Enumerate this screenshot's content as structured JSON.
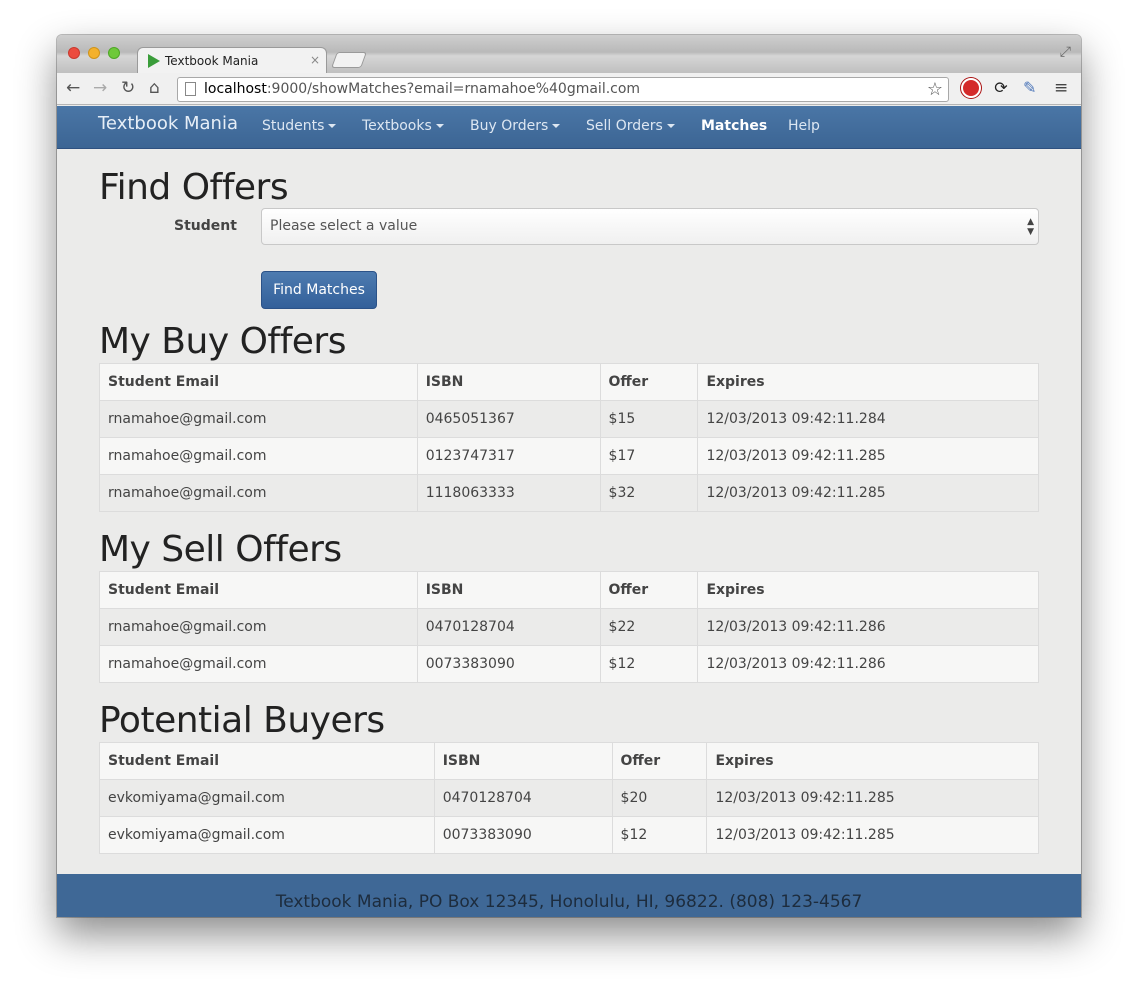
{
  "browser": {
    "tab_title": "Textbook Mania",
    "tab_close": "×",
    "url_host": "localhost",
    "url_rest": ":9000/showMatches?email=rnamahoe%40gmail.com"
  },
  "navbar": {
    "brand": "Textbook Mania",
    "items": [
      {
        "label": "Students",
        "dropdown": true
      },
      {
        "label": "Textbooks",
        "dropdown": true
      },
      {
        "label": "Buy Orders",
        "dropdown": true
      },
      {
        "label": "Sell Orders",
        "dropdown": true
      },
      {
        "label": "Matches",
        "dropdown": false,
        "active": true
      },
      {
        "label": "Help",
        "dropdown": false
      }
    ]
  },
  "find_offers": {
    "title": "Find Offers",
    "student_label": "Student",
    "select_value": "Please select a value",
    "button_label": "Find Matches"
  },
  "buy_offers": {
    "title": "My Buy Offers",
    "headers": [
      "Student Email",
      "ISBN",
      "Offer",
      "Expires"
    ],
    "rows": [
      [
        "rnamahoe@gmail.com",
        "0465051367",
        "$15",
        "12/03/2013 09:42:11.284"
      ],
      [
        "rnamahoe@gmail.com",
        "0123747317",
        "$17",
        "12/03/2013 09:42:11.285"
      ],
      [
        "rnamahoe@gmail.com",
        "1118063333",
        "$32",
        "12/03/2013 09:42:11.285"
      ]
    ]
  },
  "sell_offers": {
    "title": "My Sell Offers",
    "headers": [
      "Student Email",
      "ISBN",
      "Offer",
      "Expires"
    ],
    "rows": [
      [
        "rnamahoe@gmail.com",
        "0470128704",
        "$22",
        "12/03/2013 09:42:11.286"
      ],
      [
        "rnamahoe@gmail.com",
        "0073383090",
        "$12",
        "12/03/2013 09:42:11.286"
      ]
    ]
  },
  "potential_buyers": {
    "title": "Potential Buyers",
    "headers": [
      "Student Email",
      "ISBN",
      "Offer",
      "Expires"
    ],
    "rows": [
      [
        "evkomiyama@gmail.com",
        "0470128704",
        "$20",
        "12/03/2013 09:42:11.285"
      ],
      [
        "evkomiyama@gmail.com",
        "0073383090",
        "$12",
        "12/03/2013 09:42:11.285"
      ]
    ]
  },
  "footer": {
    "text": "Textbook Mania, PO Box 12345, Honolulu, HI, 96822. (808) 123-4567"
  }
}
